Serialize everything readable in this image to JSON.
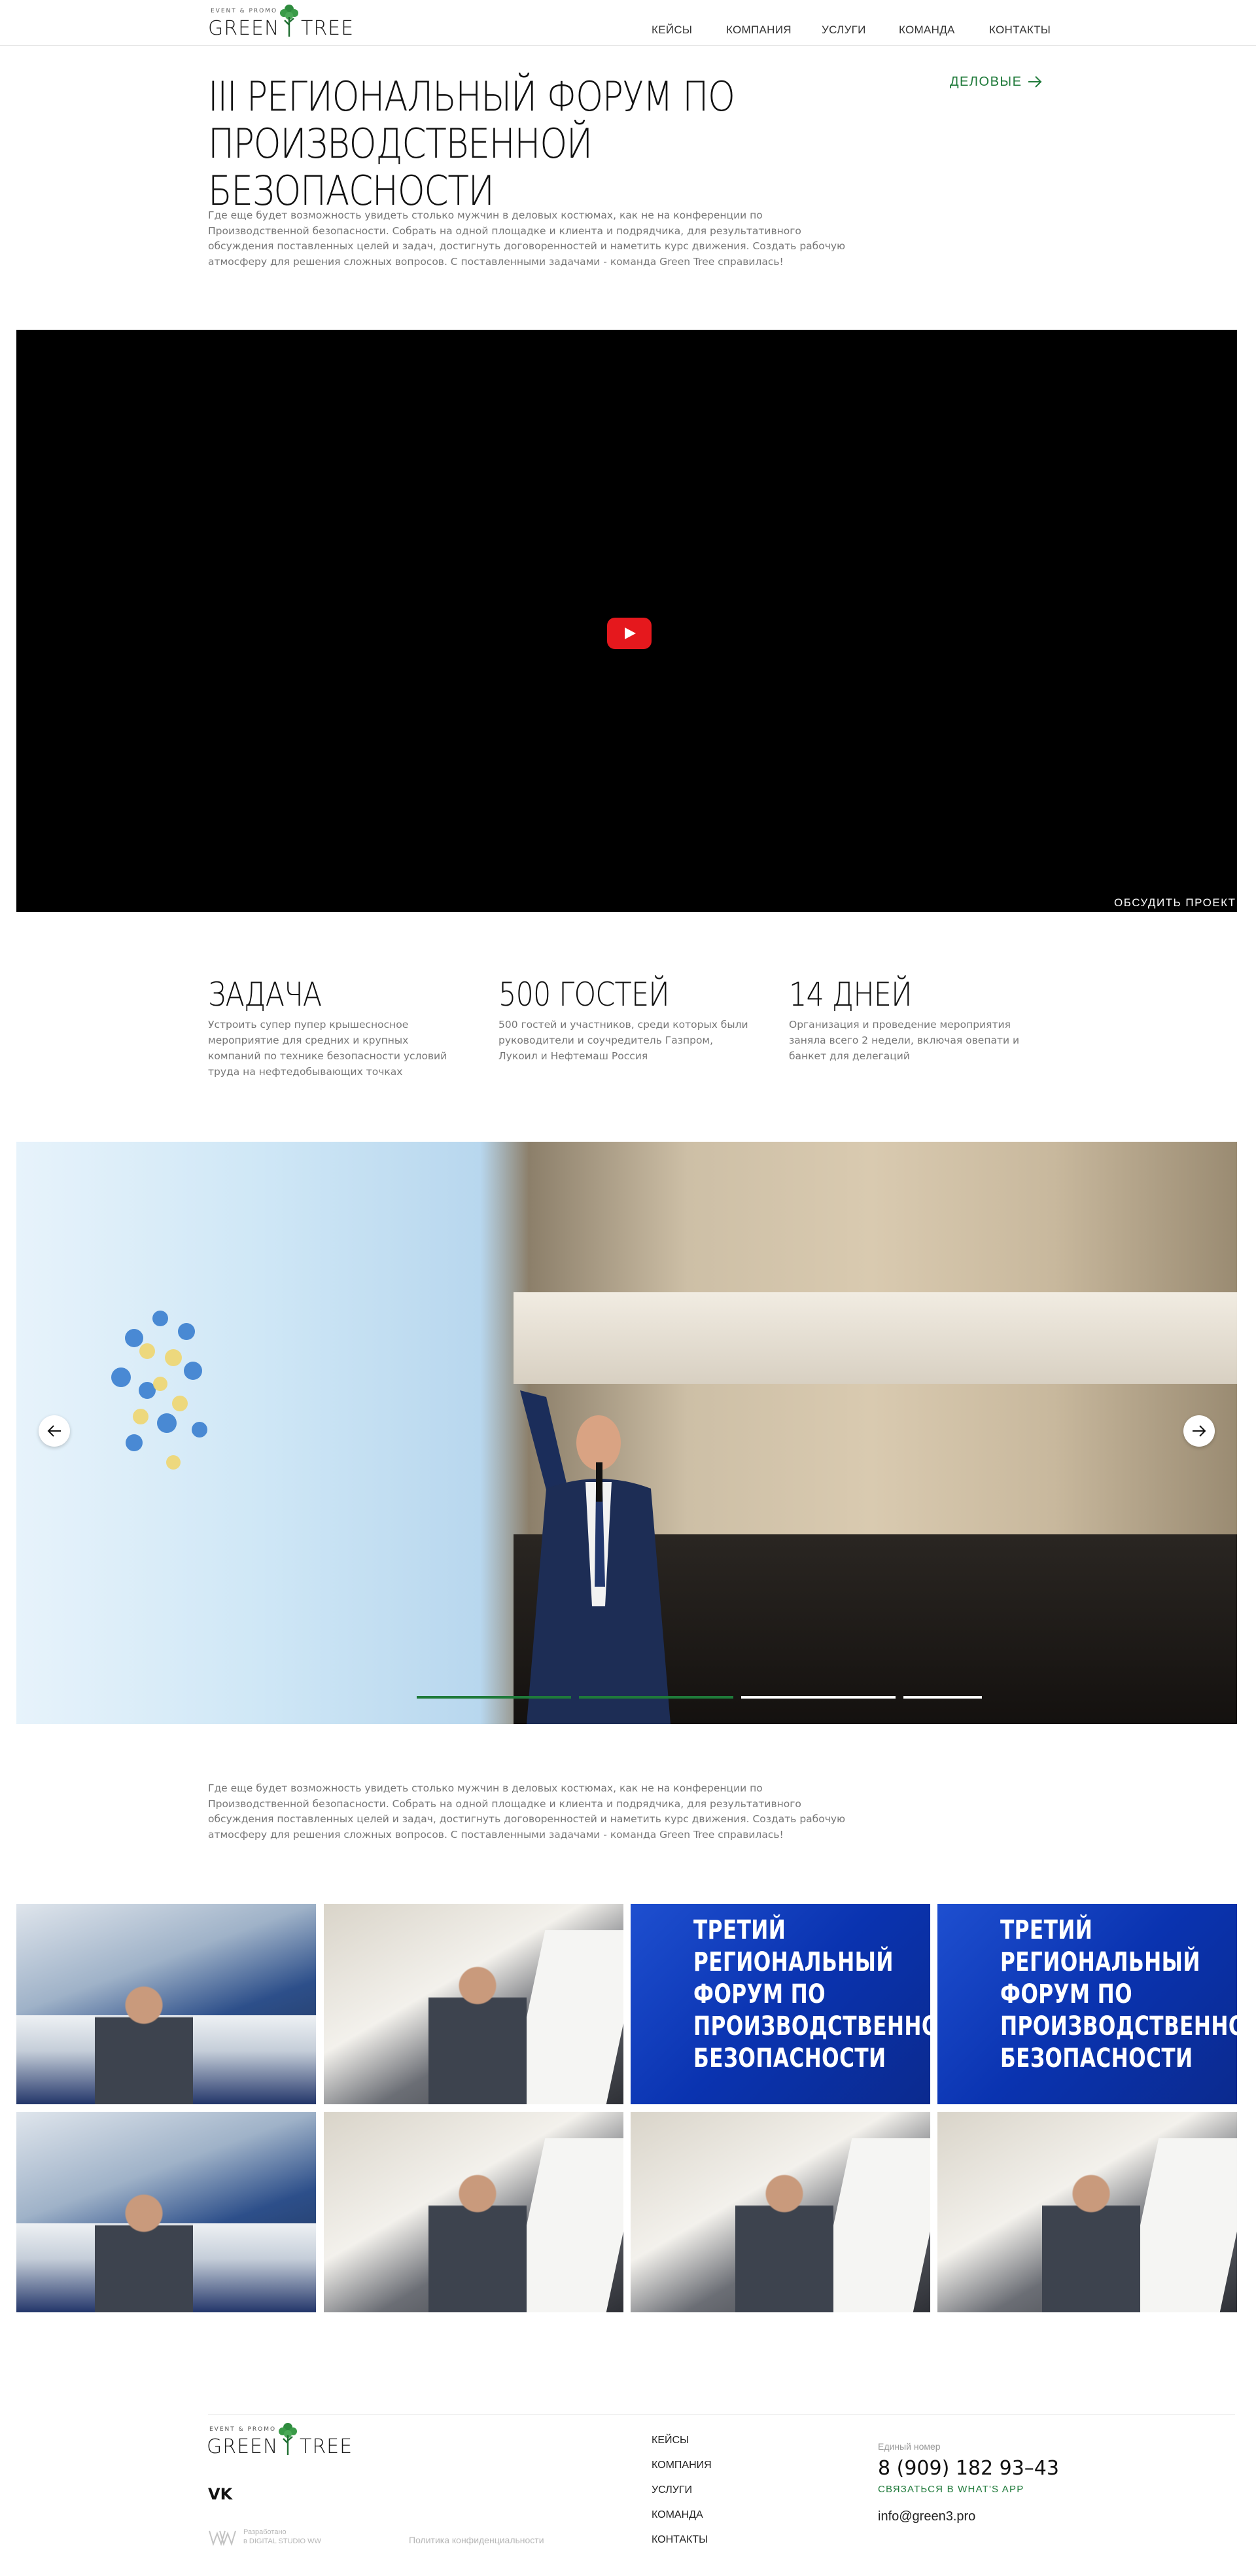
{
  "brand": {
    "tagline": "EVENT & PROMO",
    "word1": "GREEN",
    "word2": "TREE",
    "color": "#1f7a3a"
  },
  "nav": [
    {
      "label": "КЕЙСЫ"
    },
    {
      "label": "КОМПАНИЯ"
    },
    {
      "label": "УСЛУГИ"
    },
    {
      "label": "КОМАНДА"
    },
    {
      "label": "КОНТАКТЫ"
    }
  ],
  "hero": {
    "title": "III РЕГИОНАЛЬНЫЙ ФОРУМ ПО ПРОИЗВОДСТВЕННОЙ БЕЗОПАСНОСТИ",
    "category": "ДЕЛОВЫЕ",
    "category_icon": "arrow-right-icon",
    "description": "Где еще будет возможность увидеть столько мужчин в деловых костюмах, как не на конференции по Производственной безопасности. Собрать на одной площадке и клиента и подрядчика, для результативного обсуждения поставленных целей и задач, достигнуть договоренностей и наметить курс движения. Создать рабочую атмосферу для решения сложных вопросов. С поставленными задачами - команда Green Tree справилась!"
  },
  "video": {
    "play_icon": "youtube-play-icon",
    "discuss_label": "ОБСУДИТЬ ПРОЕКТ"
  },
  "stats": [
    {
      "title": "ЗАДАЧА",
      "text": "Устроить супер пупер крышесносное мероприятие для средних и крупных компаний по технике безопасности условий труда на нефтедобывающих точках"
    },
    {
      "title": "500 ГОСТЕЙ",
      "text": "500 гостей и участников, среди которых были руководители и соучредитель Газпром, Лукоил и Нефтемаш Россия"
    },
    {
      "title": "14 ДНЕЙ",
      "text": "Организация и проведение мероприятия заняла всего 2 недели, включая овепати и банкет для делегаций"
    }
  ],
  "slider": {
    "prev_icon": "arrow-left-icon",
    "next_icon": "arrow-right-icon",
    "slide_count": 4,
    "active_slide": 2,
    "active_color": "#1f7a3a"
  },
  "description2": "Где еще будет возможность увидеть столько мужчин в деловых костюмах, как не на конференции по Производственной безопасности. Собрать на одной площадке и клиента и подрядчика, для результативного обсуждения поставленных целей и задач, достигнуть договоренностей и наметить курс движения. Создать рабочую атмосферу для решения сложных вопросов. С поставленными задачами - команда Green Tree справилась!",
  "gallery": {
    "banner_text": "ТРЕТИЙ РЕГИОНАЛЬНЫЙ ФОРУМ ПО ПРОИЗВОДСТВЕННОЙ БЕЗОПАСНОСТИ",
    "items": [
      {
        "kind": "audience"
      },
      {
        "kind": "speaker"
      },
      {
        "kind": "banner"
      },
      {
        "kind": "banner"
      },
      {
        "kind": "audience"
      },
      {
        "kind": "speaker"
      },
      {
        "kind": "speaker"
      },
      {
        "kind": "speaker"
      }
    ]
  },
  "footer": {
    "social_icon": "vk-icon",
    "social_label": "VK",
    "developer": {
      "line1": "Разработано",
      "line2": "в DIGITAL STUDIO WW"
    },
    "policy": "Политика конфиденциальности",
    "nav": [
      {
        "label": "КЕЙСЫ"
      },
      {
        "label": "КОМПАНИЯ"
      },
      {
        "label": "УСЛУГИ"
      },
      {
        "label": "КОМАНДА"
      },
      {
        "label": "КОНТАКТЫ"
      }
    ],
    "phone_label": "Единый номер",
    "phone": "8 (909) 182 93–43",
    "whatsapp": "СВЯЗАТЬСЯ В WHAT'S APP",
    "email": "info@green3.pro"
  }
}
